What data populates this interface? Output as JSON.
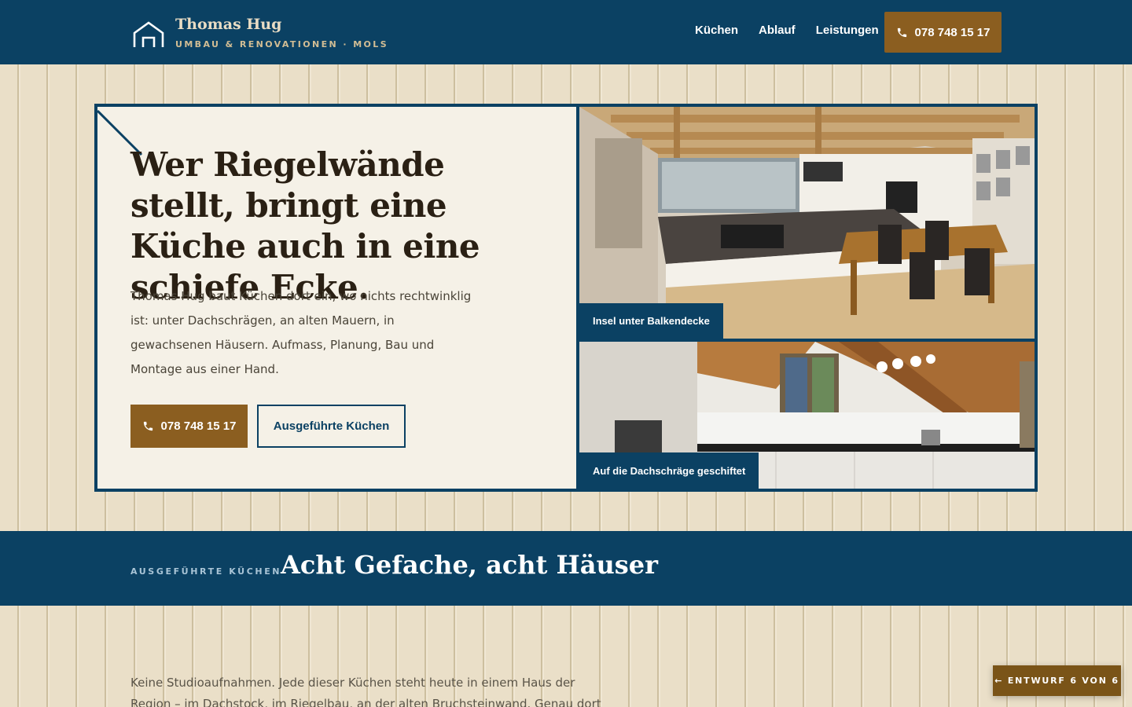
{
  "header": {
    "brand_name": "Thomas Hug",
    "brand_tagline": "UMBAU & RENOVATIONEN · MOLS",
    "nav": [
      {
        "label": "Küchen"
      },
      {
        "label": "Ablauf"
      },
      {
        "label": "Leistungen"
      }
    ],
    "phone_label": "078 748 15 17"
  },
  "hero": {
    "title": "Wer Riegelwände stellt, bringt eine Küche auch in eine schiefe Ecke.",
    "text": "Thomas Hug baut Küchen dort ein, wo nichts rechtwinklig ist: unter Dachschrägen, an alten Mauern, in gewachsenen Häusern. Aufmass, Planung, Bau und Montage aus einer Hand.",
    "primary_button": "078 748 15 17",
    "secondary_button": "Ausgeführte Küchen",
    "photos": [
      {
        "caption": "Insel unter Balkendecke"
      },
      {
        "caption": "Auf die Dachschräge geschiftet"
      }
    ]
  },
  "section": {
    "eyebrow": "AUSGEFÜHRTE KÜCHEN",
    "title": "Acht Gefache, acht Häuser",
    "intro": "Keine Studioaufnahmen. Jede dieser Küchen steht heute in einem Haus der Region – im Dachstock, im Riegelbau, an der alten Bruchsteinwand. Genau dort liegen die"
  },
  "draft_badge": "← ENTWURF 6 VON 6",
  "colors": {
    "primary": "#0b4163",
    "accent": "#8b5e20",
    "background": "#e8dcc4"
  }
}
